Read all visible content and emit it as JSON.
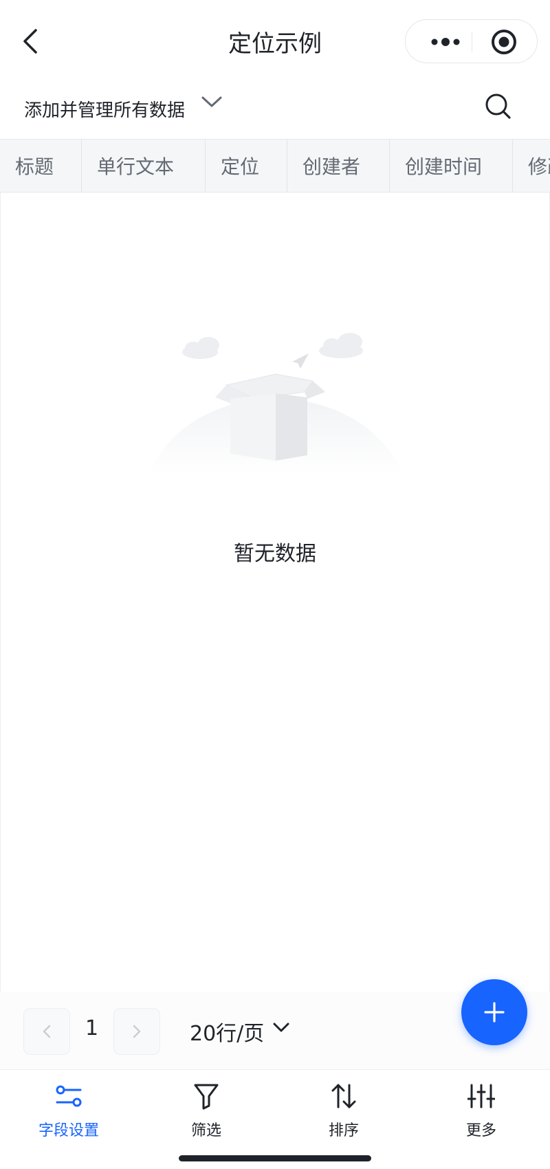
{
  "nav": {
    "title": "定位示例"
  },
  "view": {
    "label": "添加并管理所有数据"
  },
  "table": {
    "columns": [
      "标题",
      "单行文本",
      "定位",
      "创建者",
      "创建时间",
      "修改"
    ]
  },
  "empty": {
    "text": "暂无数据"
  },
  "pager": {
    "page": "1",
    "page_size": "20行/页"
  },
  "toolbar": {
    "items": [
      {
        "label": "字段设置",
        "icon": "field-settings-icon",
        "active": true
      },
      {
        "label": "筛选",
        "icon": "filter-icon",
        "active": false
      },
      {
        "label": "排序",
        "icon": "sort-icon",
        "active": false
      },
      {
        "label": "更多",
        "icon": "sliders-icon",
        "active": false
      }
    ]
  },
  "colors": {
    "accent": "#1764ff",
    "text": "#1f2329",
    "muted": "#646a73",
    "header_bg": "#f5f6f8"
  }
}
